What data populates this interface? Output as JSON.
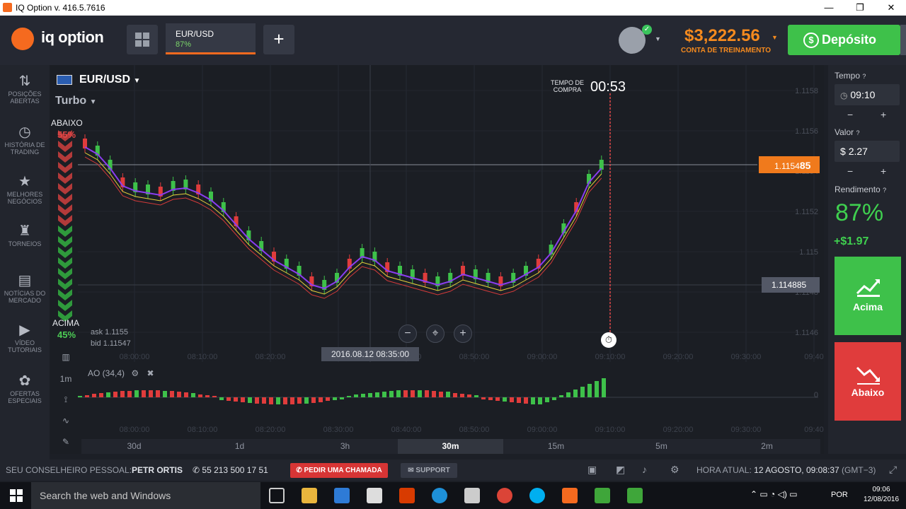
{
  "window": {
    "title": "IQ Option v. 416.5.7616",
    "minimize": "—",
    "maximize": "❐",
    "close": "✕"
  },
  "header": {
    "logo": "iq option",
    "asset_tab": {
      "name": "EUR/USD",
      "payout": "87%"
    },
    "add_tab": "+",
    "balance": "$3,222.56",
    "account_type": "CONTA DE TREINAMENTO",
    "deposit_label": "Depósito"
  },
  "sidebar": {
    "items": [
      {
        "label": "POSIÇÕES ABERTAS",
        "icon": "arrows-icon"
      },
      {
        "label": "HISTÓRIA DE TRADING",
        "icon": "history-icon"
      },
      {
        "label": "MELHORES NEGÓCIOS",
        "icon": "star-icon"
      },
      {
        "label": "TORNEIOS",
        "icon": "trophy-icon"
      },
      {
        "label": "NOTÍCIAS DO MERCADO",
        "icon": "news-icon"
      },
      {
        "label": "VÍDEO TUTORIAIS",
        "icon": "play-icon"
      },
      {
        "label": "OFERTAS ESPECIAIS",
        "icon": "gift-icon"
      }
    ]
  },
  "chart": {
    "pair": "EUR/USD",
    "mode": "Turbo",
    "down_label": "ABAIXO",
    "down_pct": "55%",
    "up_label": "ACIMA",
    "up_pct": "45%",
    "ask": "ask 1.1155",
    "bid": "bid 1.11547",
    "timer_label_1": "TEMPO DE",
    "timer_label_2": "COMPRA",
    "timer": "00:53",
    "current_price_main": "1.1154",
    "current_price_tail": "85",
    "strike_price": "1.114885",
    "crosshair_date": "2016.08.12 08:35:00",
    "y_ticks": [
      "1.1158",
      "1.1156",
      "1.1154",
      "1.1152",
      "1.115",
      "1.1148",
      "1.1146"
    ],
    "x_ticks": [
      "08:00:00",
      "08:10:00",
      "08:20:00",
      "08:30:00",
      "08:40:00",
      "08:50:00",
      "09:00:00",
      "09:10:00",
      "09:20:00",
      "09:30:00",
      "09:40"
    ],
    "indicator_label": "AO (34,4)",
    "indicator_zero": "0",
    "timeframes": [
      "30d",
      "1d",
      "3h",
      "30m",
      "15m",
      "5m",
      "2m"
    ],
    "active_timeframe": "30m",
    "chart_tool_1m": "1m"
  },
  "right_panel": {
    "time_label": "Tempo",
    "time_value": "09:10",
    "amount_label": "Valor",
    "amount_currency": "$",
    "amount_value": "2.27",
    "yield_label": "Rendimento",
    "yield_pct": "87%",
    "profit": "+$1.97",
    "up_button": "Acima",
    "down_button": "Abaixo",
    "minus": "−",
    "plus": "+"
  },
  "footer": {
    "advisor_label": "SEU CONSELHEIRO PESSOAL:",
    "advisor_name": "PETR ORTIS",
    "phone": "55 213 500 17 51",
    "call_button": "PEDIR UMA CHAMADA",
    "support_button": "SUPPORT",
    "time_label": "HORA ATUAL:",
    "time_value": "12 AGOSTO, 09:08:37",
    "timezone": "(GMT−3)"
  },
  "taskbar": {
    "search_placeholder": "Search the web and Windows",
    "lang": "POR",
    "clock_time": "09:06",
    "clock_date": "12/08/2016"
  },
  "colors": {
    "accent": "#f56a1f",
    "up": "#3ec14a",
    "down": "#e03c3c",
    "balance": "#f58a1e"
  }
}
